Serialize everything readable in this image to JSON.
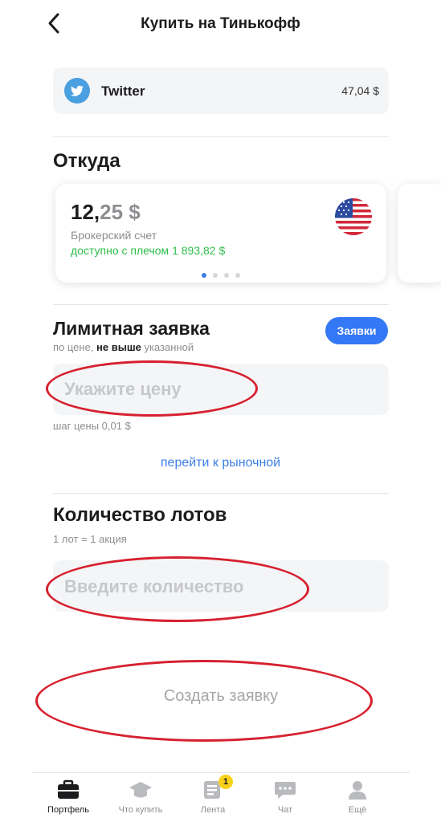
{
  "header": {
    "title": "Купить на Тинькофф",
    "back_icon": "chevron-left-icon"
  },
  "stock": {
    "name": "Twitter",
    "price": "47,04 $",
    "logo_icon": "twitter-bird-icon"
  },
  "source": {
    "title": "Откуда",
    "account": {
      "amount_main": "12,",
      "amount_cents": "25 $",
      "name": "Брокерский счет",
      "available": "доступно с плечом 1 893,82 $",
      "flag_icon": "us-flag-icon"
    },
    "pager": {
      "count": 4,
      "active": 0
    }
  },
  "limit": {
    "title": "Лимитная заявка",
    "subtitle_start": "по цене, ",
    "subtitle_bold": "не выше",
    "subtitle_end": " указанной",
    "orders_button": "Заявки",
    "price_placeholder": "Укажите цену",
    "step": "шаг цены 0,01 $",
    "market_link": "перейти к рыночной"
  },
  "lots": {
    "title": "Количество лотов",
    "subtitle": "1 лот = 1 акция",
    "quantity_placeholder": "Введите количество"
  },
  "submit_label": "Создать заявку",
  "tabs": [
    {
      "label": "Портфель",
      "icon": "briefcase-icon",
      "active": true
    },
    {
      "label": "Что купить",
      "icon": "graduation-cap-icon",
      "active": false
    },
    {
      "label": "Лента",
      "icon": "feed-icon",
      "active": false,
      "badge": "1"
    },
    {
      "label": "Чат",
      "icon": "chat-icon",
      "active": false
    },
    {
      "label": "Ещё",
      "icon": "user-icon",
      "active": false
    }
  ],
  "colors": {
    "accent": "#3478f6",
    "available": "#2dbd4a",
    "annotation": "#d6202e",
    "badge": "#f8d11a"
  }
}
